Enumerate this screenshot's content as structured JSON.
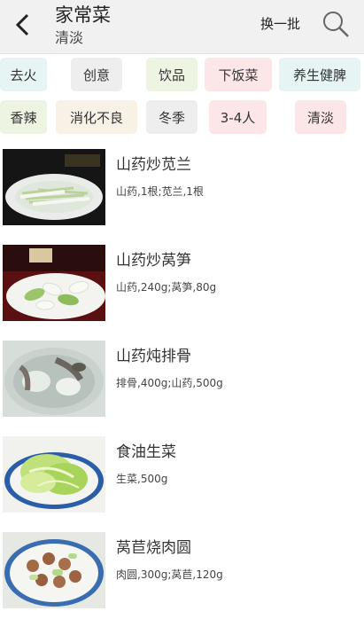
{
  "header": {
    "title": "家常菜",
    "subtitle": "清淡",
    "refresh_label": "换一批"
  },
  "icons": {
    "back": "back-arrow-icon",
    "search": "search-icon"
  },
  "colors": {
    "header_bg": "#f1f1f1",
    "tag_gray": "#eeeeee",
    "tag_green": "#eef4e2",
    "tag_pink": "#fce6e8",
    "tag_cyan": "#e6f4f4",
    "tag_beige": "#f8f1e6"
  },
  "tags": [
    {
      "label": "去火"
    },
    {
      "label": "创意"
    },
    {
      "label": "饮品"
    },
    {
      "label": "下饭菜"
    },
    {
      "label": "养生健脾"
    },
    {
      "label": "香辣"
    },
    {
      "label": "消化不良"
    },
    {
      "label": "冬季"
    },
    {
      "label": "3-4人"
    },
    {
      "label": "清淡"
    }
  ],
  "recipes": [
    {
      "name": "山药炒苋兰",
      "ingredients": "山药,1根;苋兰,1根"
    },
    {
      "name": "山药炒莴笋",
      "ingredients": "山药,240g;莴笋,80g"
    },
    {
      "name": "山药炖排骨",
      "ingredients": "排骨,400g;山药,500g"
    },
    {
      "name": "食油生菜",
      "ingredients": "生菜,500g"
    },
    {
      "name": "莴苣烧肉圆",
      "ingredients": "肉圆,300g;莴苣,120g"
    }
  ]
}
